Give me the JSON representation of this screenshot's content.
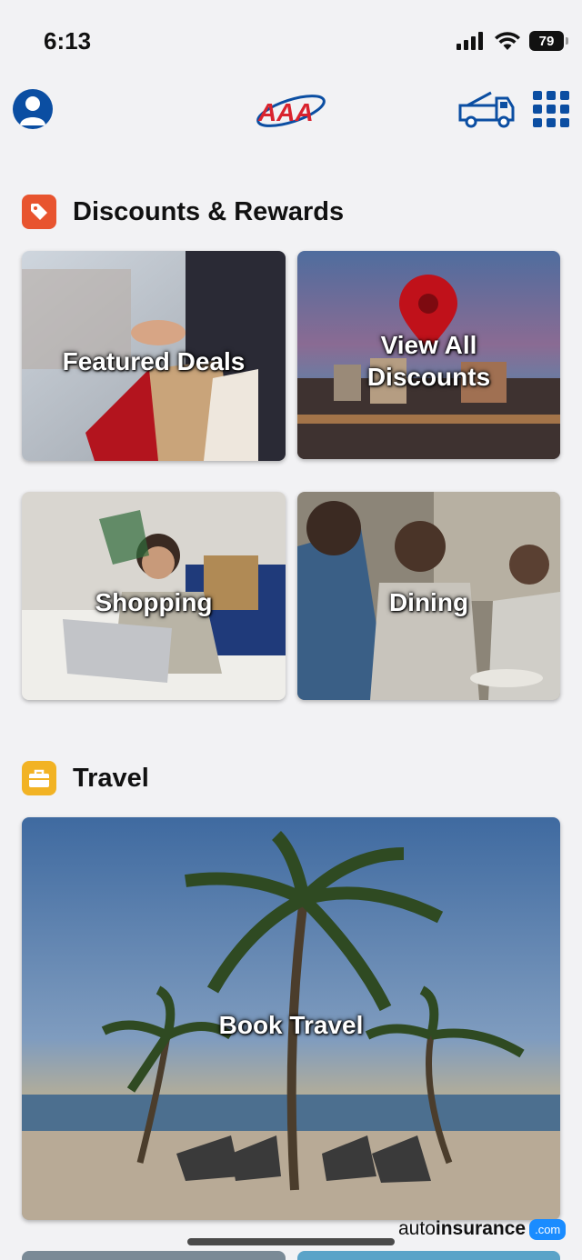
{
  "status_bar": {
    "time": "6:13",
    "battery": "79"
  },
  "header": {
    "profile_icon": "person-icon",
    "logo_text": "AAA",
    "roadside_icon": "tow-truck-icon",
    "menu_icon": "grid-menu-icon"
  },
  "sections": {
    "discounts": {
      "title": "Discounts & Rewards",
      "icon": "price-tag-icon",
      "icon_color": "#e8542f",
      "tiles": [
        {
          "label": "Featured Deals"
        },
        {
          "label_line1": "View All",
          "label_line2": "Discounts"
        },
        {
          "label": "Shopping"
        },
        {
          "label": "Dining"
        }
      ]
    },
    "travel": {
      "title": "Travel",
      "icon": "briefcase-icon",
      "icon_color": "#f2b324",
      "tiles": [
        {
          "label": "Book Travel"
        }
      ]
    }
  },
  "watermark": {
    "part1": "auto",
    "part2": "insurance",
    "part3": ".com"
  },
  "colors": {
    "brand_blue": "#0b4ea2",
    "brand_red": "#d9232e",
    "background": "#f2f2f4"
  }
}
